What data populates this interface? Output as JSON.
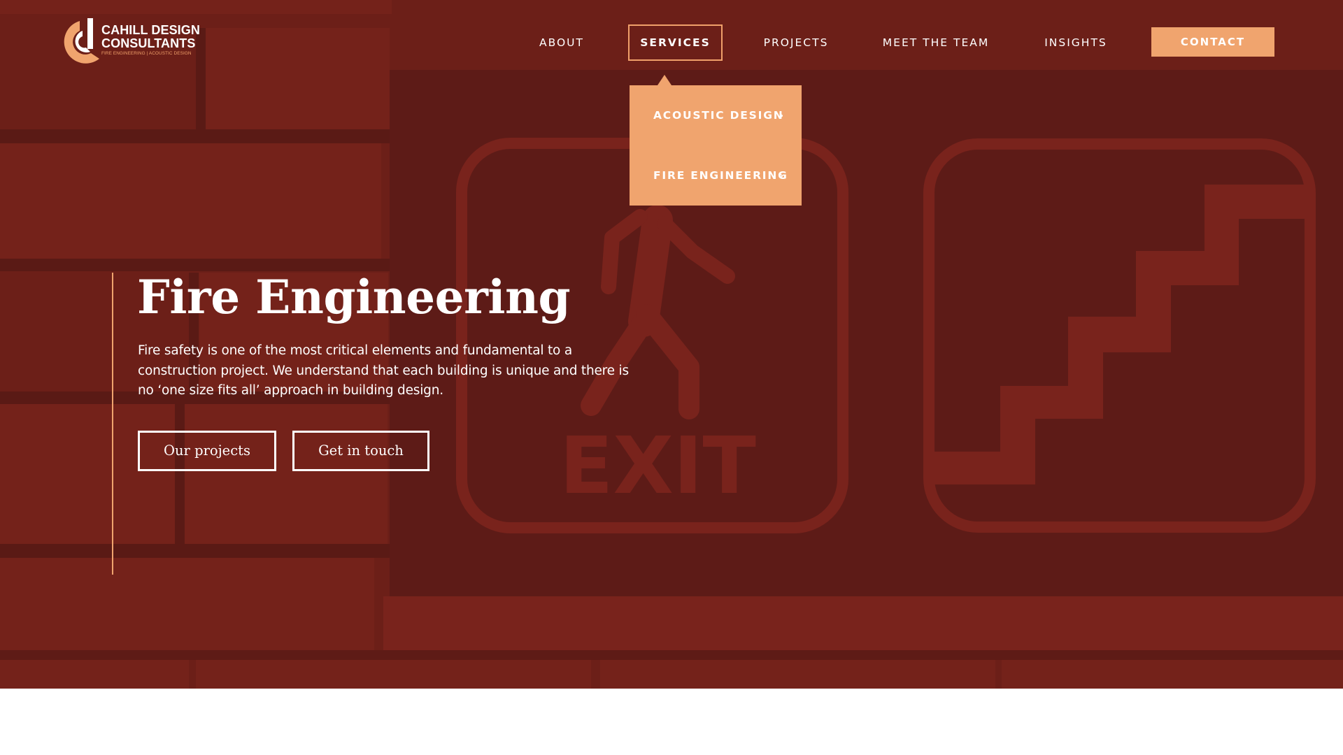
{
  "brand": {
    "name_line1": "CAHILL DESIGN",
    "name_line2": "CONSULTANTS",
    "tagline": "FIRE ENGINEERING | ACOUSTIC DESIGN",
    "icon": "cd-logo-mark"
  },
  "nav": {
    "items": [
      {
        "label": "ABOUT"
      },
      {
        "label": "SERVICES",
        "active": true
      },
      {
        "label": "PROJECTS"
      },
      {
        "label": "MEET THE TEAM"
      },
      {
        "label": "INSIGHTS"
      }
    ],
    "contact_label": "CONTACT"
  },
  "services_dropdown": {
    "items": [
      {
        "label": "ACOUSTIC DESIGN",
        "icon": "chevron-right-icon"
      },
      {
        "label": "FIRE ENGINEERING",
        "icon": "chevron-right-icon"
      }
    ],
    "chevron_glyph": "›"
  },
  "hero": {
    "title": "Fire Engineering",
    "description": "Fire safety is one of the most critical elements and fundamental to a construction project. We understand that each building is unique and there is no ‘one size fits all’ approach in building design.",
    "buttons": [
      {
        "label": "Our projects"
      },
      {
        "label": "Get in touch"
      }
    ],
    "background_image": "brick wall with exit and stairs signs",
    "exit_sign_text": "EXIT"
  },
  "colors": {
    "accent": "#f0a46e",
    "overlay": "#6c1f18",
    "text": "#ffffff"
  }
}
